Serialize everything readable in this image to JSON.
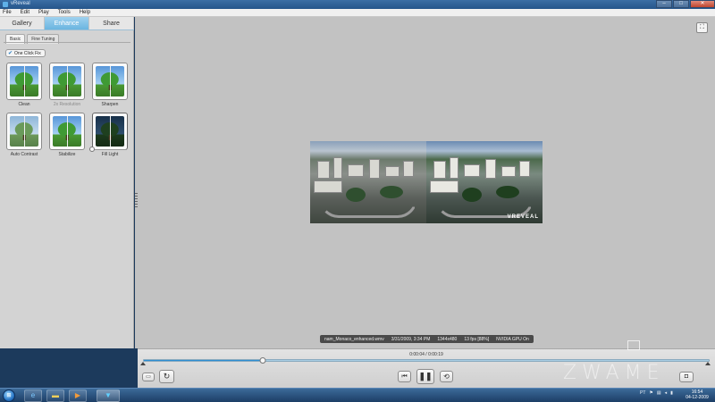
{
  "window": {
    "title": "vReveal",
    "controls": {
      "minimize": "–",
      "maximize": "□",
      "close": "✕"
    }
  },
  "menu": [
    "File",
    "Edit",
    "Play",
    "Tools",
    "Help"
  ],
  "tabs": [
    {
      "label": "Gallery",
      "active": false
    },
    {
      "label": "Enhance",
      "active": true
    },
    {
      "label": "Share",
      "active": false
    }
  ],
  "subtabs": [
    {
      "label": "Basic",
      "active": true
    },
    {
      "label": "Fine Tuning",
      "active": false
    }
  ],
  "one_click": {
    "label": "One Click Fix",
    "icon": "wand-icon"
  },
  "effects": [
    {
      "label": "Clean",
      "enabled": true
    },
    {
      "label": "2x Resolution",
      "enabled": false
    },
    {
      "label": "Sharpen",
      "enabled": true
    },
    {
      "label": "Auto Contrast",
      "enabled": true
    },
    {
      "label": "Stabilize",
      "enabled": true
    },
    {
      "label": "Fill Light",
      "enabled": true,
      "level": 0
    }
  ],
  "video": {
    "watermark": "VREVEAL"
  },
  "info": {
    "filename": "nam_Monaco_enhanced.wmv",
    "date": "3/31/2009, 3:34 PM",
    "resolution": "1344x480",
    "fps": "13 fps [88%]",
    "gpu": "NVIDIA GPU On"
  },
  "playback": {
    "time": "0:00:04 / 0:00:19",
    "progress_percent": 21
  },
  "taskbar": {
    "start_icon": "windows-orb-icon",
    "apps": [
      "ie-icon",
      "explorer-icon",
      "media-player-icon",
      "vreveal-icon"
    ],
    "lang": "PT",
    "clock_time": "16:54",
    "clock_date": "04-12-2009"
  },
  "overlay": {
    "site": "ZWAME"
  },
  "colors": {
    "accent": "#6ab5e0",
    "seek_fill": "#2d8ed2"
  }
}
